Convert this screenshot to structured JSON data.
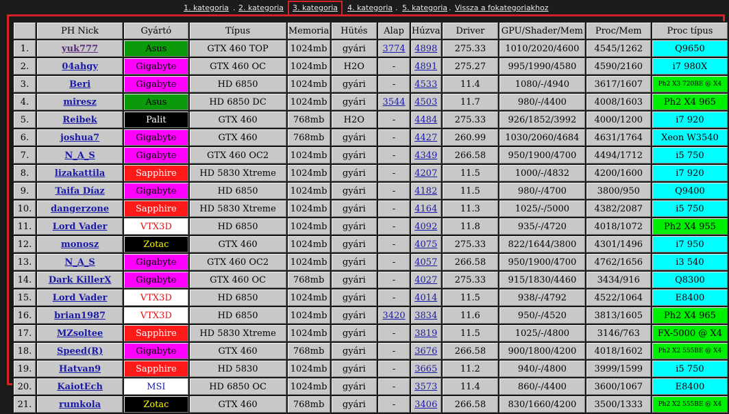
{
  "nav": {
    "items": [
      "1. kategoria",
      "2. kategoria",
      "3. kategoria",
      "4. kategoria",
      "5. kategoria",
      "Vissza a fokategoriakhoz"
    ],
    "separator": " . ",
    "active_index": 2
  },
  "table": {
    "headers": [
      "",
      "PH Nick",
      "Gyártó",
      "Típus",
      "Memoria",
      "Hütés",
      "Alap",
      "Húzva",
      "Driver",
      "GPU/Shader/Mem",
      "Proc/Mem",
      "Proc típus"
    ],
    "rows": [
      {
        "n": "1.",
        "nick": "yuk777",
        "maker": "Asus",
        "type": "GTX 460 TOP",
        "mem": "1024mb",
        "cool": "gyári",
        "alap": "3774",
        "huzva": "4898",
        "driver": "275.33",
        "gpu": "1010/2020/4600",
        "proc": "4545/1262",
        "cpu": "Q9650"
      },
      {
        "n": "2.",
        "nick": "04ahgy",
        "maker": "Gigabyte",
        "type": "GTX 460 OC",
        "mem": "1024mb",
        "cool": "H2O",
        "alap": "-",
        "huzva": "4891",
        "driver": "275.27",
        "gpu": "995/1990/4580",
        "proc": "4590/2160",
        "cpu": "i7 980X"
      },
      {
        "n": "3.",
        "nick": "Beri",
        "maker": "Gigabyte",
        "type": "HD 6850",
        "mem": "1024mb",
        "cool": "gyári",
        "alap": "-",
        "huzva": "4533",
        "driver": "11.4",
        "gpu": "1080/-/4940",
        "proc": "3617/1607",
        "cpu": "Ph2 X3 720BE @ X4"
      },
      {
        "n": "4.",
        "nick": "miresz",
        "maker": "Asus",
        "type": "HD 6850 DC",
        "mem": "1024mb",
        "cool": "gyári",
        "alap": "3544",
        "huzva": "4503",
        "driver": "11.7",
        "gpu": "980/-/4400",
        "proc": "4008/1603",
        "cpu": "Ph2 X4 965"
      },
      {
        "n": "5.",
        "nick": "Reibek",
        "maker": "Palit",
        "type": "GTX 460",
        "mem": "768mb",
        "cool": "H2O",
        "alap": "-",
        "huzva": "4484",
        "driver": "275.33",
        "gpu": "926/1852/3992",
        "proc": "4000/1200",
        "cpu": "i7 920"
      },
      {
        "n": "6.",
        "nick": "joshua7",
        "maker": "Gigabyte",
        "type": "GTX 460",
        "mem": "768mb",
        "cool": "gyári",
        "alap": "-",
        "huzva": "4427",
        "driver": "260.99",
        "gpu": "1030/2060/4684",
        "proc": "4631/1764",
        "cpu": "Xeon W3540"
      },
      {
        "n": "7.",
        "nick": "N_A_S",
        "maker": "Gigabyte",
        "type": "GTX 460 OC2",
        "mem": "1024mb",
        "cool": "gyári",
        "alap": "-",
        "huzva": "4349",
        "driver": "266.58",
        "gpu": "950/1900/4700",
        "proc": "4494/1712",
        "cpu": "i5 750"
      },
      {
        "n": "8.",
        "nick": "lizakattila",
        "maker": "Sapphire",
        "type": "HD 5830 Xtreme",
        "mem": "1024mb",
        "cool": "gyári",
        "alap": "-",
        "huzva": "4207",
        "driver": "11.5",
        "gpu": "1000/-/4832",
        "proc": "4200/1600",
        "cpu": "i7 920"
      },
      {
        "n": "9.",
        "nick": "Taifa Díaz",
        "maker": "Gigabyte",
        "type": "HD 6850",
        "mem": "1024mb",
        "cool": "gyári",
        "alap": "-",
        "huzva": "4182",
        "driver": "11.5",
        "gpu": "980/-/4700",
        "proc": "3800/950",
        "cpu": "Q9400"
      },
      {
        "n": "10.",
        "nick": "dangerzone",
        "maker": "Sapphire",
        "type": "HD 5830 Xtreme",
        "mem": "1024mb",
        "cool": "gyári",
        "alap": "-",
        "huzva": "4164",
        "driver": "11.3",
        "gpu": "1025/-/5000",
        "proc": "4382/2087",
        "cpu": "i5 750"
      },
      {
        "n": "11.",
        "nick": "Lord Vader",
        "maker": "VTX3D",
        "type": "HD 6850",
        "mem": "1024mb",
        "cool": "gyári",
        "alap": "-",
        "huzva": "4092",
        "driver": "11.8",
        "gpu": "935/-/4720",
        "proc": "4018/1072",
        "cpu": "Ph2 X4 955"
      },
      {
        "n": "12.",
        "nick": "monosz",
        "maker": "Zotac",
        "type": "GTX 460",
        "mem": "1024mb",
        "cool": "gyári",
        "alap": "-",
        "huzva": "4075",
        "driver": "275.33",
        "gpu": "822/1644/3800",
        "proc": "4301/1496",
        "cpu": "i7 950"
      },
      {
        "n": "13.",
        "nick": "N_A_S",
        "maker": "Gigabyte",
        "type": "GTX 460 OC2",
        "mem": "1024mb",
        "cool": "gyári",
        "alap": "-",
        "huzva": "4057",
        "driver": "266.58",
        "gpu": "950/1900/4700",
        "proc": "4762/1656",
        "cpu": "i3 540"
      },
      {
        "n": "14.",
        "nick": "Dark KillerX",
        "maker": "Gigabyte",
        "type": "GTX 460 OC",
        "mem": "768mb",
        "cool": "gyári",
        "alap": "-",
        "huzva": "4027",
        "driver": "275.33",
        "gpu": "915/1830/4460",
        "proc": "3434/916",
        "cpu": "Q8300"
      },
      {
        "n": "15.",
        "nick": "Lord Vader",
        "maker": "VTX3D",
        "type": "HD 6850",
        "mem": "1024mb",
        "cool": "gyári",
        "alap": "-",
        "huzva": "4014",
        "driver": "11.5",
        "gpu": "938/-/4792",
        "proc": "4522/1064",
        "cpu": "E8400"
      },
      {
        "n": "16.",
        "nick": "brian1987",
        "maker": "VTX3D",
        "type": "HD 6850",
        "mem": "1024mb",
        "cool": "gyári",
        "alap": "3420",
        "huzva": "3834",
        "driver": "11.6",
        "gpu": "950/-/4520",
        "proc": "3813/1605",
        "cpu": "Ph2 X4 965"
      },
      {
        "n": "17.",
        "nick": "MZsoltee",
        "maker": "Sapphire",
        "type": "HD 5830 Xtreme",
        "mem": "1024mb",
        "cool": "gyári",
        "alap": "-",
        "huzva": "3819",
        "driver": "11.5",
        "gpu": "1025/-/4800",
        "proc": "3146/763",
        "cpu": "FX-5000 @ X4"
      },
      {
        "n": "18.",
        "nick": "Speed(R)",
        "maker": "Gigabyte",
        "type": "GTX 460",
        "mem": "768mb",
        "cool": "gyári",
        "alap": "-",
        "huzva": "3676",
        "driver": "266.58",
        "gpu": "900/1800/4200",
        "proc": "4018/1602",
        "cpu": "Ph2 X2 555BE @ X4"
      },
      {
        "n": "19.",
        "nick": "Hatvan9",
        "maker": "Sapphire",
        "type": "HD 5830",
        "mem": "1024mb",
        "cool": "gyári",
        "alap": "-",
        "huzva": "3665",
        "driver": "11.2",
        "gpu": "940/-/4800",
        "proc": "3999/1599",
        "cpu": "i5 750"
      },
      {
        "n": "20.",
        "nick": "KaiotEch",
        "maker": "MSI",
        "type": "HD 6850 OC",
        "mem": "1024mb",
        "cool": "gyári",
        "alap": "-",
        "huzva": "3573",
        "driver": "11.4",
        "gpu": "860/-/4400",
        "proc": "3600/1067",
        "cpu": "E8400"
      },
      {
        "n": "21.",
        "nick": "rumkola",
        "maker": "Zotac",
        "type": "GTX 460",
        "mem": "768mb",
        "cool": "gyári",
        "alap": "-",
        "huzva": "3406",
        "driver": "266.58",
        "gpu": "830/1660/4200",
        "proc": "3500/1333",
        "cpu": "Ph2 X2 555BE @ X4"
      }
    ]
  },
  "colors": {
    "maker": {
      "Asus": {
        "bg": "#0a9a0a",
        "fg": "#000000"
      },
      "Gigabyte": {
        "bg": "#ff00ff",
        "fg": "#000000"
      },
      "Palit": {
        "bg": "#000000",
        "fg": "#ffffff"
      },
      "Sapphire": {
        "bg": "#ff1a1a",
        "fg": "#ffffff"
      },
      "VTX3D": {
        "bg": "#ffffff",
        "fg": "#e01010"
      },
      "Zotac": {
        "bg": "#000000",
        "fg": "#ffff00"
      },
      "MSI": {
        "bg": "#ffffff",
        "fg": "#1a1aa8"
      }
    },
    "cpu_intel": "#00ffff",
    "cpu_amd": "#00ee00",
    "gpu_red": "#e01010",
    "frame": "#d2222a"
  }
}
